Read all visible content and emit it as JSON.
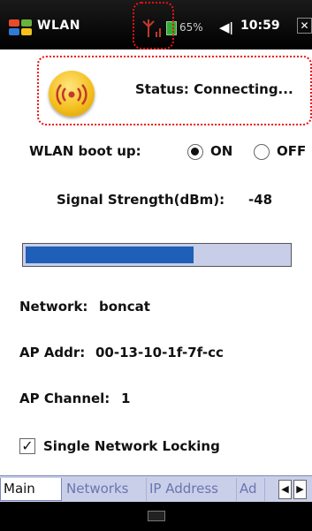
{
  "statusbar": {
    "app_title": "WLAN",
    "battery_text": "65%",
    "volume_icon": "◀€",
    "time": "10:59",
    "close_label": "✕"
  },
  "status": {
    "text": "Status: Connecting...",
    "icon": "wifi-signal-icon"
  },
  "boot_up": {
    "label": "WLAN boot up:",
    "on_label": "ON",
    "off_label": "OFF",
    "selected": "ON"
  },
  "signal": {
    "label": "Signal Strength(dBm):",
    "value": "-48",
    "level": 0.64
  },
  "network": {
    "label": "Network:",
    "value": "boncat"
  },
  "ap_addr": {
    "label": "AP Addr:",
    "value": "00-13-10-1f-7f-cc"
  },
  "ap_channel": {
    "label": "AP Channel:",
    "value": "1"
  },
  "single_network": {
    "label": "Single Network Locking",
    "checked": true
  },
  "tabs": [
    {
      "label": "Main",
      "active": true
    },
    {
      "label": "Networks",
      "active": false
    },
    {
      "label": "IP Address",
      "active": false
    },
    {
      "label": "Ad",
      "active": false
    }
  ],
  "tab_arrows": {
    "left": "◀",
    "right": "▶"
  },
  "colors": {
    "accent": "#1f5fb8",
    "highlight": "#e11111"
  }
}
